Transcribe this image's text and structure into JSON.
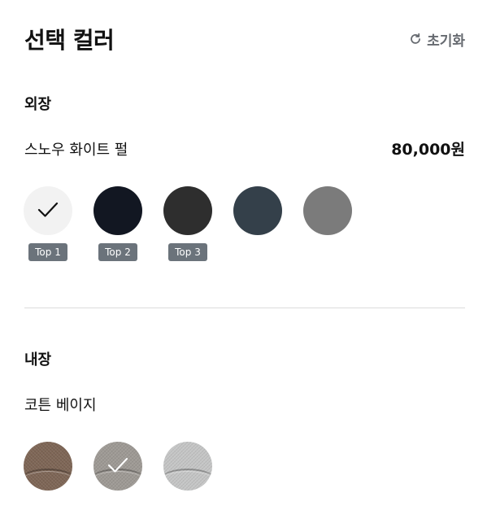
{
  "header": {
    "title": "선택 컬러",
    "reset_label": "초기화",
    "reset_icon": "refresh-icon"
  },
  "exterior": {
    "section_title": "외장",
    "selected_name": "스노우 화이트 펄",
    "price": "80,000원",
    "swatches": [
      {
        "color": "#f2f2f2",
        "selected": true,
        "badge": "Top 1"
      },
      {
        "color": "#121722",
        "selected": false,
        "badge": "Top 2"
      },
      {
        "color": "#2e2e2e",
        "selected": false,
        "badge": "Top 3"
      },
      {
        "color": "#34404a",
        "selected": false,
        "badge": ""
      },
      {
        "color": "#7b7b7b",
        "selected": false,
        "badge": ""
      }
    ]
  },
  "interior": {
    "section_title": "내장",
    "selected_name": "코튼 베이지",
    "swatches": [
      {
        "color": "#7e6656",
        "selected": false
      },
      {
        "color": "#9e9a95",
        "selected": true
      },
      {
        "color": "#c5c6c6",
        "selected": false
      }
    ]
  },
  "colors": {
    "badge_bg": "#6b737b",
    "divider": "#dcdcdc",
    "secondary_text": "#666a70"
  }
}
